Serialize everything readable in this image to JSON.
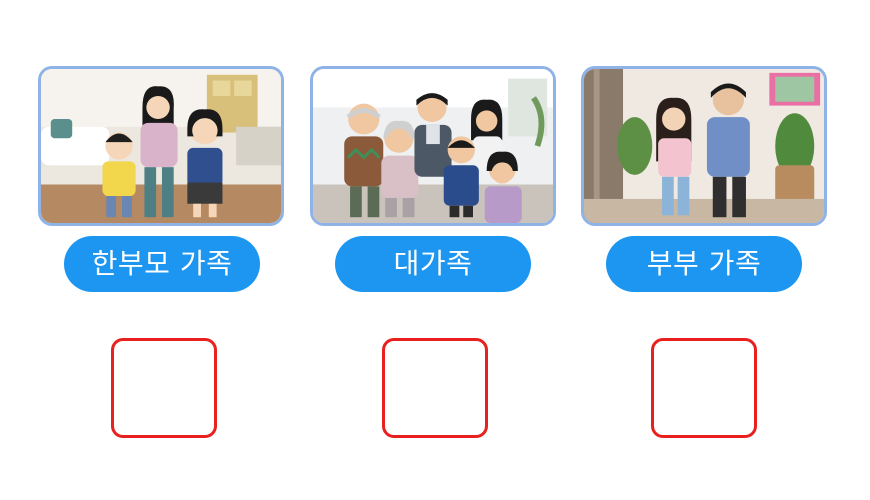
{
  "colors": {
    "pill_background": "#1c96f0",
    "pill_text": "#ffffff",
    "answer_box_border": "#e8201e",
    "card_border": "#8fb3e6"
  },
  "cards": [
    {
      "label": "한부모 가족",
      "image": "single-parent-family-illustration"
    },
    {
      "label": "대가족",
      "image": "extended-family-illustration"
    },
    {
      "label": "부부 가족",
      "image": "married-couple-family-illustration"
    }
  ]
}
